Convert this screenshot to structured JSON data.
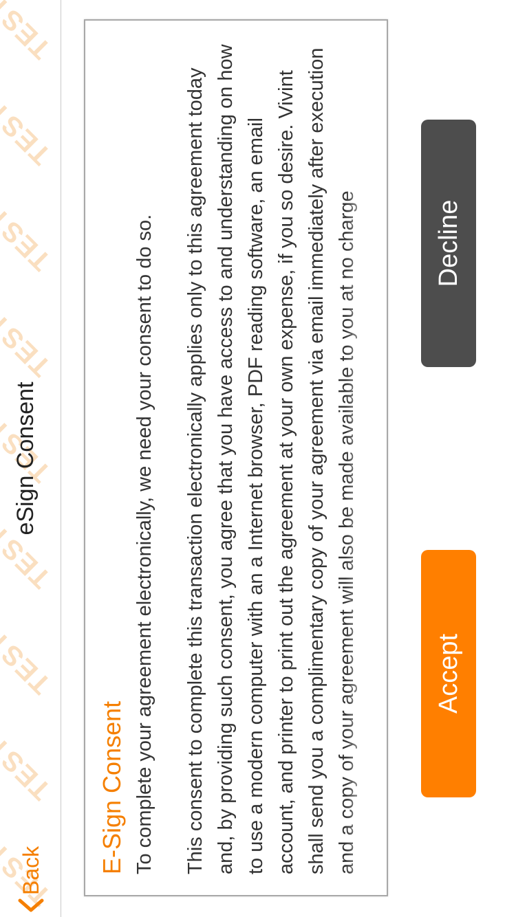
{
  "header": {
    "back_label": "Back",
    "title": "eSign Consent",
    "watermark": "TEST"
  },
  "card": {
    "title": "E-Sign Consent",
    "intro": "To complete your agreement electronically, we need your consent to do so.",
    "body": "This consent to complete this transaction electronically applies only to this agreement today and, by providing such consent, you agree that you have access to and understanding on how to use a modern computer with an a Internet browser, PDF reading software, an email account, and printer to print out the agreement at your own expense, if you so desire. Vivint shall send you a complimentary copy of your agreement via email immediately after execution and a copy of your agreement will also be made available to you at no charge"
  },
  "buttons": {
    "accept": "Accept",
    "decline": "Decline"
  },
  "colors": {
    "accent": "#ff7f00",
    "decline": "#4d4d4d",
    "title_orange": "#f57f00"
  },
  "icons": {
    "back": "chevron-left-icon"
  }
}
